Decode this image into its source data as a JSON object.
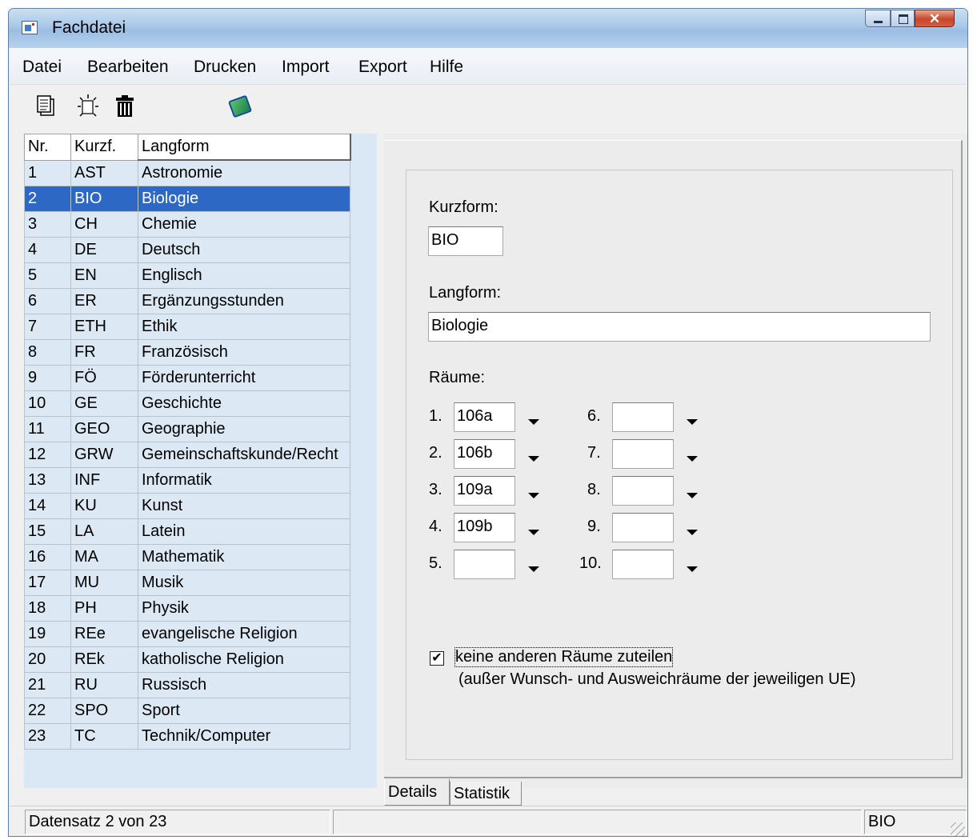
{
  "window": {
    "title": "Fachdatei"
  },
  "menu": [
    "Datei",
    "Bearbeiten",
    "Drucken",
    "Import",
    "Export",
    "Hilfe"
  ],
  "toolbar": {
    "buttons": [
      "new-record-icon",
      "properties-icon",
      "delete-icon",
      "book-icon"
    ]
  },
  "table": {
    "headers": [
      "Nr.",
      "Kurzf.",
      "Langform"
    ],
    "selected_index": 1,
    "rows": [
      [
        "1",
        "AST",
        "Astronomie"
      ],
      [
        "2",
        "BIO",
        "Biologie"
      ],
      [
        "3",
        "CH",
        "Chemie"
      ],
      [
        "4",
        "DE",
        "Deutsch"
      ],
      [
        "5",
        "EN",
        "Englisch"
      ],
      [
        "6",
        "ER",
        "Ergänzungsstunden"
      ],
      [
        "7",
        "ETH",
        "Ethik"
      ],
      [
        "8",
        "FR",
        "Französisch"
      ],
      [
        "9",
        "FÖ",
        "Förderunterricht"
      ],
      [
        "10",
        "GE",
        "Geschichte"
      ],
      [
        "11",
        "GEO",
        "Geographie"
      ],
      [
        "12",
        "GRW",
        "Gemeinschaftskunde/Recht"
      ],
      [
        "13",
        "INF",
        "Informatik"
      ],
      [
        "14",
        "KU",
        "Kunst"
      ],
      [
        "15",
        "LA",
        "Latein"
      ],
      [
        "16",
        "MA",
        "Mathematik"
      ],
      [
        "17",
        "MU",
        "Musik"
      ],
      [
        "18",
        "PH",
        "Physik"
      ],
      [
        "19",
        "REe",
        "evangelische Religion"
      ],
      [
        "20",
        "REk",
        "katholische Religion"
      ],
      [
        "21",
        "RU",
        "Russisch"
      ],
      [
        "22",
        "SPO",
        "Sport"
      ],
      [
        "23",
        "TC",
        "Technik/Computer"
      ]
    ]
  },
  "details": {
    "kurzform_label": "Kurzform:",
    "kurzform_value": "BIO",
    "langform_label": "Langform:",
    "langform_value": "Biologie",
    "raeume_label": "Räume:",
    "rooms": [
      {
        "num": "1.",
        "value": "106a"
      },
      {
        "num": "2.",
        "value": "106b"
      },
      {
        "num": "3.",
        "value": "109a"
      },
      {
        "num": "4.",
        "value": "109b"
      },
      {
        "num": "5.",
        "value": ""
      },
      {
        "num": "6.",
        "value": ""
      },
      {
        "num": "7.",
        "value": ""
      },
      {
        "num": "8.",
        "value": ""
      },
      {
        "num": "9.",
        "value": ""
      },
      {
        "num": "10.",
        "value": ""
      }
    ],
    "checkbox_checked": true,
    "checkbox_label": "keine anderen Räume zuteilen",
    "checkbox_note": "(außer Wunsch- und Ausweichräume der jeweiligen UE)"
  },
  "tabs": {
    "details": "Details",
    "statistik": "Statistik"
  },
  "status": {
    "record": "Datensatz 2 von 23",
    "middle": "",
    "code": "BIO"
  }
}
